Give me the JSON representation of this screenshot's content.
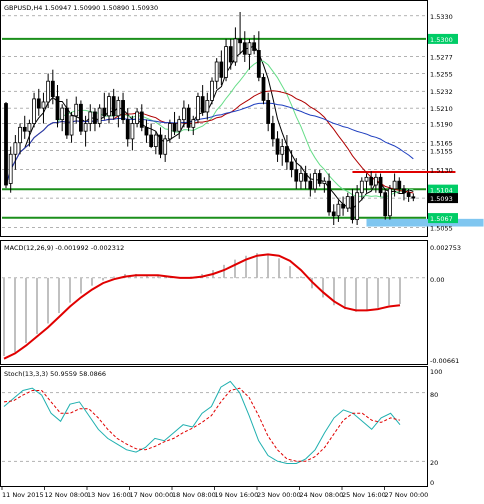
{
  "chart_data": {
    "type": "candlestick",
    "symbol_header": "GBPUSD,H4  1.50947 1.50990 1.50890 1.50930",
    "colors": {
      "candle": "#000000",
      "sma_black": "#000000",
      "sma_blue": "#1f3fbf",
      "sma_red": "#b00000",
      "sma_green": "#66dd88",
      "level_green": "#1b8f1b",
      "level_red": "#e00000",
      "grid": "#666666",
      "price_label_bg": "#00cc66",
      "current_price_bg": "#000000",
      "zone_fill": "#7fc6f0",
      "macd_line": "#e00000",
      "macd_hist": "#c0c0c0",
      "stoch_main": "#20b0b0",
      "stoch_signal": "#e00000"
    },
    "price_axis": {
      "ymin": 1.5045,
      "ymax": 1.5348,
      "labels": [
        "1.5330",
        "1.5300",
        "1.5277",
        "1.5255",
        "1.5232",
        "1.5210",
        "1.5190",
        "1.5165",
        "1.5155",
        "1.5130",
        "1.5104",
        "1.5093",
        "1.5067",
        "1.5055"
      ],
      "boxed_labels": [
        "1.5300",
        "1.5104",
        "1.5093",
        "1.5067"
      ]
    },
    "horizontal_levels": [
      {
        "price": 1.53,
        "color": "green"
      },
      {
        "price": 1.5127,
        "color": "red",
        "from_candle": 74,
        "to_candle": 96
      },
      {
        "price": 1.51045,
        "color": "green"
      },
      {
        "price": 1.50675,
        "color": "green"
      }
    ],
    "support_zone": {
      "from_candle": 77,
      "to_candle": 102,
      "low": 1.5056,
      "high": 1.5066
    },
    "candles": [
      [
        1.5216,
        1.5218,
        1.5106,
        1.511
      ],
      [
        1.5112,
        1.516,
        1.51,
        1.515
      ],
      [
        1.515,
        1.5175,
        1.513,
        1.5165
      ],
      [
        1.5165,
        1.519,
        1.515,
        1.5185
      ],
      [
        1.5185,
        1.52,
        1.517,
        1.518
      ],
      [
        1.518,
        1.5195,
        1.516,
        1.519
      ],
      [
        1.519,
        1.523,
        1.5185,
        1.5222
      ],
      [
        1.5222,
        1.5235,
        1.52,
        1.521
      ],
      [
        1.521,
        1.523,
        1.519,
        1.5218
      ],
      [
        1.5218,
        1.5255,
        1.521,
        1.5245
      ],
      [
        1.5245,
        1.526,
        1.5215,
        1.5225
      ],
      [
        1.5225,
        1.524,
        1.5185,
        1.5195
      ],
      [
        1.5195,
        1.5215,
        1.518,
        1.521
      ],
      [
        1.521,
        1.5222,
        1.517,
        1.5175
      ],
      [
        1.5175,
        1.5205,
        1.5165,
        1.52
      ],
      [
        1.52,
        1.5225,
        1.519,
        1.5215
      ],
      [
        1.5215,
        1.522,
        1.5175,
        1.518
      ],
      [
        1.518,
        1.52,
        1.516,
        1.519
      ],
      [
        1.519,
        1.5215,
        1.518,
        1.5205
      ],
      [
        1.5205,
        1.521,
        1.518,
        1.519
      ],
      [
        1.519,
        1.5215,
        1.5185,
        1.521
      ],
      [
        1.521,
        1.523,
        1.5195,
        1.52
      ],
      [
        1.52,
        1.523,
        1.519,
        1.5225
      ],
      [
        1.5225,
        1.5235,
        1.5195,
        1.52
      ],
      [
        1.52,
        1.5225,
        1.5185,
        1.522
      ],
      [
        1.522,
        1.523,
        1.519,
        1.5195
      ],
      [
        1.5195,
        1.521,
        1.516,
        1.517
      ],
      [
        1.517,
        1.52,
        1.5155,
        1.519
      ],
      [
        1.519,
        1.521,
        1.5185,
        1.5205
      ],
      [
        1.5205,
        1.5215,
        1.518,
        1.5185
      ],
      [
        1.5185,
        1.5195,
        1.5165,
        1.5175
      ],
      [
        1.5175,
        1.519,
        1.5158,
        1.516
      ],
      [
        1.516,
        1.518,
        1.515,
        1.5175
      ],
      [
        1.5175,
        1.5185,
        1.5145,
        1.515
      ],
      [
        1.515,
        1.5175,
        1.514,
        1.517
      ],
      [
        1.517,
        1.5195,
        1.5165,
        1.519
      ],
      [
        1.519,
        1.5205,
        1.5175,
        1.518
      ],
      [
        1.518,
        1.52,
        1.517,
        1.5195
      ],
      [
        1.5195,
        1.522,
        1.5185,
        1.521
      ],
      [
        1.521,
        1.5215,
        1.518,
        1.5185
      ],
      [
        1.5185,
        1.52,
        1.5175,
        1.5195
      ],
      [
        1.5195,
        1.523,
        1.519,
        1.5225
      ],
      [
        1.5225,
        1.524,
        1.52,
        1.5205
      ],
      [
        1.5205,
        1.523,
        1.5195,
        1.522
      ],
      [
        1.522,
        1.525,
        1.5215,
        1.5245
      ],
      [
        1.5245,
        1.5275,
        1.5235,
        1.527
      ],
      [
        1.527,
        1.5285,
        1.524,
        1.525
      ],
      [
        1.525,
        1.53,
        1.5245,
        1.529
      ],
      [
        1.529,
        1.53,
        1.526,
        1.527
      ],
      [
        1.527,
        1.5315,
        1.5265,
        1.53
      ],
      [
        1.53,
        1.5335,
        1.528,
        1.5295
      ],
      [
        1.5295,
        1.531,
        1.527,
        1.528
      ],
      [
        1.528,
        1.53,
        1.526,
        1.5295
      ],
      [
        1.5295,
        1.5305,
        1.528,
        1.5285
      ],
      [
        1.5285,
        1.531,
        1.5245,
        1.525
      ],
      [
        1.525,
        1.5255,
        1.5215,
        1.522
      ],
      [
        1.522,
        1.523,
        1.518,
        1.519
      ],
      [
        1.519,
        1.52,
        1.516,
        1.517
      ],
      [
        1.517,
        1.518,
        1.514,
        1.515
      ],
      [
        1.515,
        1.517,
        1.5135,
        1.516
      ],
      [
        1.516,
        1.5175,
        1.513,
        1.514
      ],
      [
        1.514,
        1.5155,
        1.512,
        1.513
      ],
      [
        1.513,
        1.5145,
        1.5105,
        1.5115
      ],
      [
        1.5115,
        1.5135,
        1.5105,
        1.5125
      ],
      [
        1.5125,
        1.5135,
        1.5105,
        1.5115
      ],
      [
        1.5115,
        1.5125,
        1.5095,
        1.5105
      ],
      [
        1.5105,
        1.513,
        1.51,
        1.5125
      ],
      [
        1.5125,
        1.513,
        1.5108,
        1.5112
      ],
      [
        1.5112,
        1.512,
        1.51,
        1.5115
      ],
      [
        1.5115,
        1.5125,
        1.507,
        1.5075
      ],
      [
        1.5075,
        1.5085,
        1.5058,
        1.507
      ],
      [
        1.507,
        1.509,
        1.5062,
        1.5085
      ],
      [
        1.5085,
        1.5095,
        1.507,
        1.508
      ],
      [
        1.508,
        1.51,
        1.5075,
        1.5095
      ],
      [
        1.5095,
        1.5105,
        1.506,
        1.5065
      ],
      [
        1.5065,
        1.511,
        1.5058,
        1.51
      ],
      [
        1.51,
        1.512,
        1.509,
        1.5115
      ],
      [
        1.5115,
        1.5125,
        1.51,
        1.512
      ],
      [
        1.512,
        1.5128,
        1.5105,
        1.511
      ],
      [
        1.511,
        1.5125,
        1.51,
        1.512
      ],
      [
        1.512,
        1.5125,
        1.5095,
        1.51
      ],
      [
        1.51,
        1.5105,
        1.5065,
        1.507
      ],
      [
        1.507,
        1.511,
        1.5065,
        1.5105
      ],
      [
        1.5105,
        1.5125,
        1.5095,
        1.5115
      ],
      [
        1.5115,
        1.512,
        1.51,
        1.5105
      ],
      [
        1.5105,
        1.511,
        1.509,
        1.51
      ],
      [
        1.51,
        1.5105,
        1.5088,
        1.5095
      ],
      [
        1.50947,
        1.5099,
        1.5089,
        1.5093
      ]
    ],
    "macd": {
      "label": "MACD(12,26,9) -0.001992 -0.002312",
      "ymin": -0.00661,
      "ymax": 0.002753,
      "axis_labels": [
        "0.002753",
        "0.00",
        "-0.00661"
      ],
      "signal_line": [
        -0.0062,
        -0.0058,
        -0.0052,
        -0.0045,
        -0.0038,
        -0.003,
        -0.0022,
        -0.0015,
        -0.0009,
        -0.0004,
        -0.0001,
        0.0001,
        0.0002,
        0.0002,
        0.0002,
        0.0001,
        0.0,
        0.0,
        0.0001,
        0.0003,
        0.0006,
        0.001,
        0.0014,
        0.0017,
        0.0018,
        0.0017,
        0.0013,
        0.0006,
        -0.0003,
        -0.0011,
        -0.0018,
        -0.0023,
        -0.0025,
        -0.0025,
        -0.0024,
        -0.0022,
        -0.0021
      ],
      "histogram": [
        -0.006,
        -0.0057,
        -0.005,
        -0.0043,
        -0.0035,
        -0.0027,
        -0.0019,
        -0.0012,
        -0.0006,
        -0.0002,
        0.0001,
        0.0003,
        0.0003,
        0.0002,
        0.0002,
        0.0001,
        0.0,
        0.0001,
        0.0003,
        0.0006,
        0.001,
        0.0014,
        0.0017,
        0.0019,
        0.0018,
        0.0015,
        0.0009,
        0.0001,
        -0.0008,
        -0.0015,
        -0.0021,
        -0.0024,
        -0.0026,
        -0.0025,
        -0.0023,
        -0.0021,
        -0.002
      ]
    },
    "stoch": {
      "label": "Stoch(13,3,3) 50.9559 58.0866",
      "axis_labels": [
        "100",
        "80",
        "20",
        "0"
      ],
      "main": [
        68,
        75,
        82,
        84,
        78,
        62,
        55,
        70,
        72,
        60,
        48,
        40,
        35,
        30,
        28,
        32,
        40,
        38,
        45,
        52,
        50,
        62,
        68,
        85,
        90,
        80,
        60,
        38,
        25,
        20,
        18,
        18,
        22,
        30,
        45,
        58,
        65,
        62,
        55,
        48,
        58,
        62,
        52
      ],
      "signal": [
        72,
        73,
        78,
        82,
        82,
        72,
        62,
        62,
        66,
        66,
        58,
        48,
        40,
        35,
        31,
        30,
        33,
        37,
        40,
        45,
        49,
        54,
        60,
        72,
        82,
        84,
        76,
        60,
        42,
        30,
        22,
        20,
        20,
        24,
        32,
        44,
        56,
        62,
        62,
        56,
        54,
        58,
        56
      ]
    },
    "x_axis_labels": [
      "11 Nov 2015",
      "12 Nov 08:00",
      "13 Nov 16:00",
      "17 Nov 00:00",
      "18 Nov 08:00",
      "19 Nov 16:00",
      "23 Nov 00:00",
      "24 Nov 08:00",
      "25 Nov 16:00",
      "27 Nov 00:00"
    ]
  }
}
